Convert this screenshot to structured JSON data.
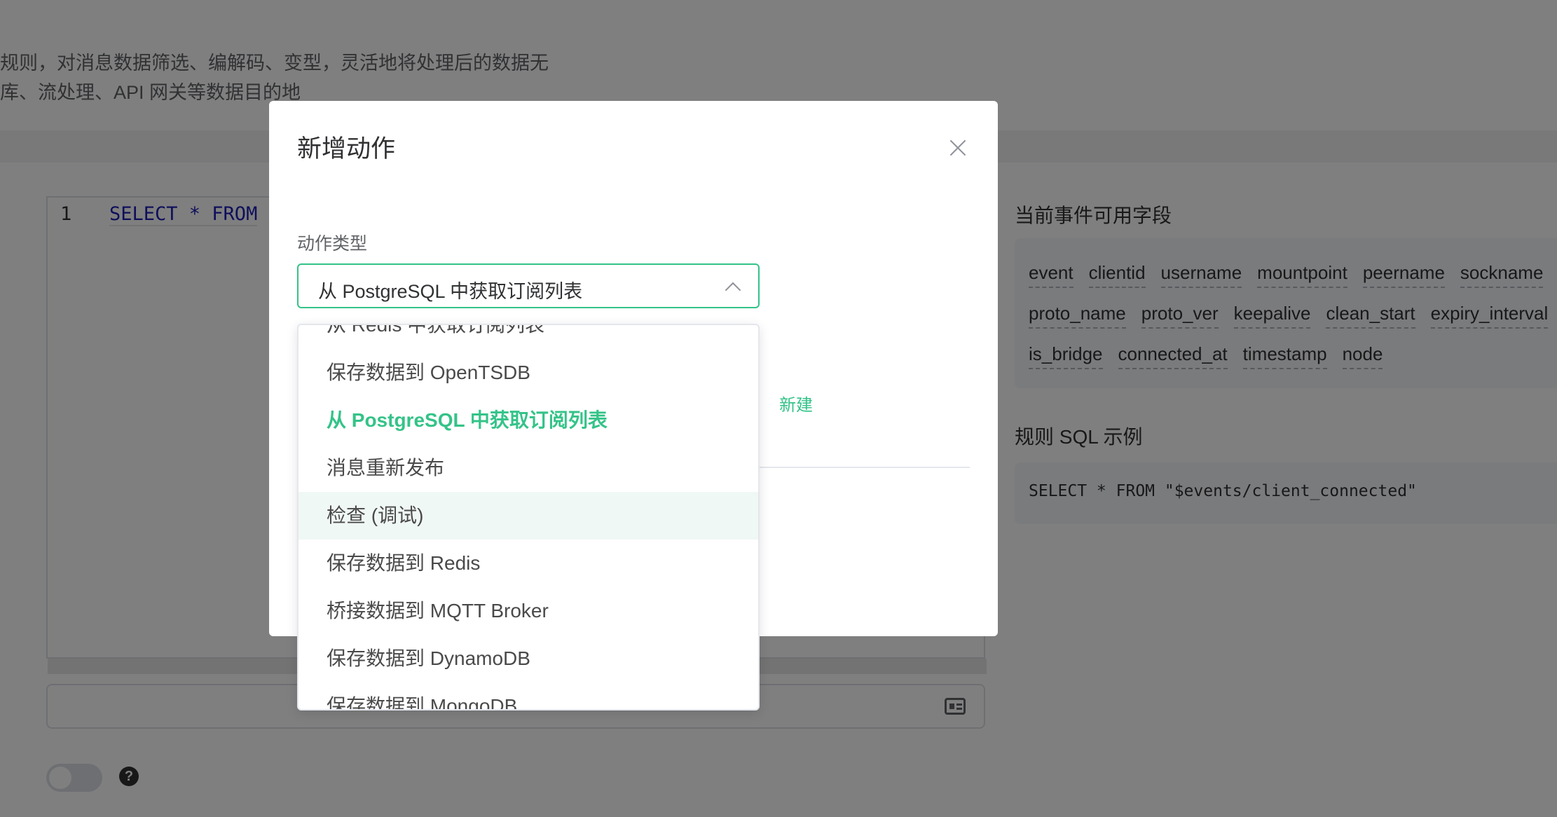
{
  "background": {
    "desc_line1": "规则，对消息数据筛选、编解码、变型，灵活地将处理后的数据无",
    "desc_line2": "库、流处理、API 网关等数据目的地",
    "editor": {
      "line_number": "1",
      "code": "SELECT * FROM"
    },
    "fields_title": "当前事件可用字段",
    "fields_rows": [
      [
        "event",
        "clientid",
        "username",
        "mountpoint",
        "peername",
        "sockname"
      ],
      [
        "proto_name",
        "proto_ver",
        "keepalive",
        "clean_start",
        "expiry_interval"
      ],
      [
        "is_bridge",
        "connected_at",
        "timestamp",
        "node"
      ]
    ],
    "sql_example_title": "规则 SQL 示例",
    "sql_example": "SELECT * FROM \"$events/client_connected\"",
    "help_icon_glyph": "?"
  },
  "dialog": {
    "title": "新增动作",
    "action_type_label": "动作类型",
    "selected_value": "从 PostgreSQL 中获取订阅列表",
    "new_link": "新建"
  },
  "dropdown": {
    "options": [
      "从 Redis 中获取订阅列表",
      "保存数据到 OpenTSDB",
      "从 PostgreSQL 中获取订阅列表",
      "消息重新发布",
      "检查 (调试)",
      "保存数据到 Redis",
      "桥接数据到 MQTT Broker",
      "保存数据到 DynamoDB",
      "保存数据到 MongoDB"
    ],
    "selected_index": 2,
    "hover_index": 4
  },
  "colors": {
    "accent": "#34c388",
    "overlay": "rgba(0,0,0,0.5)"
  }
}
